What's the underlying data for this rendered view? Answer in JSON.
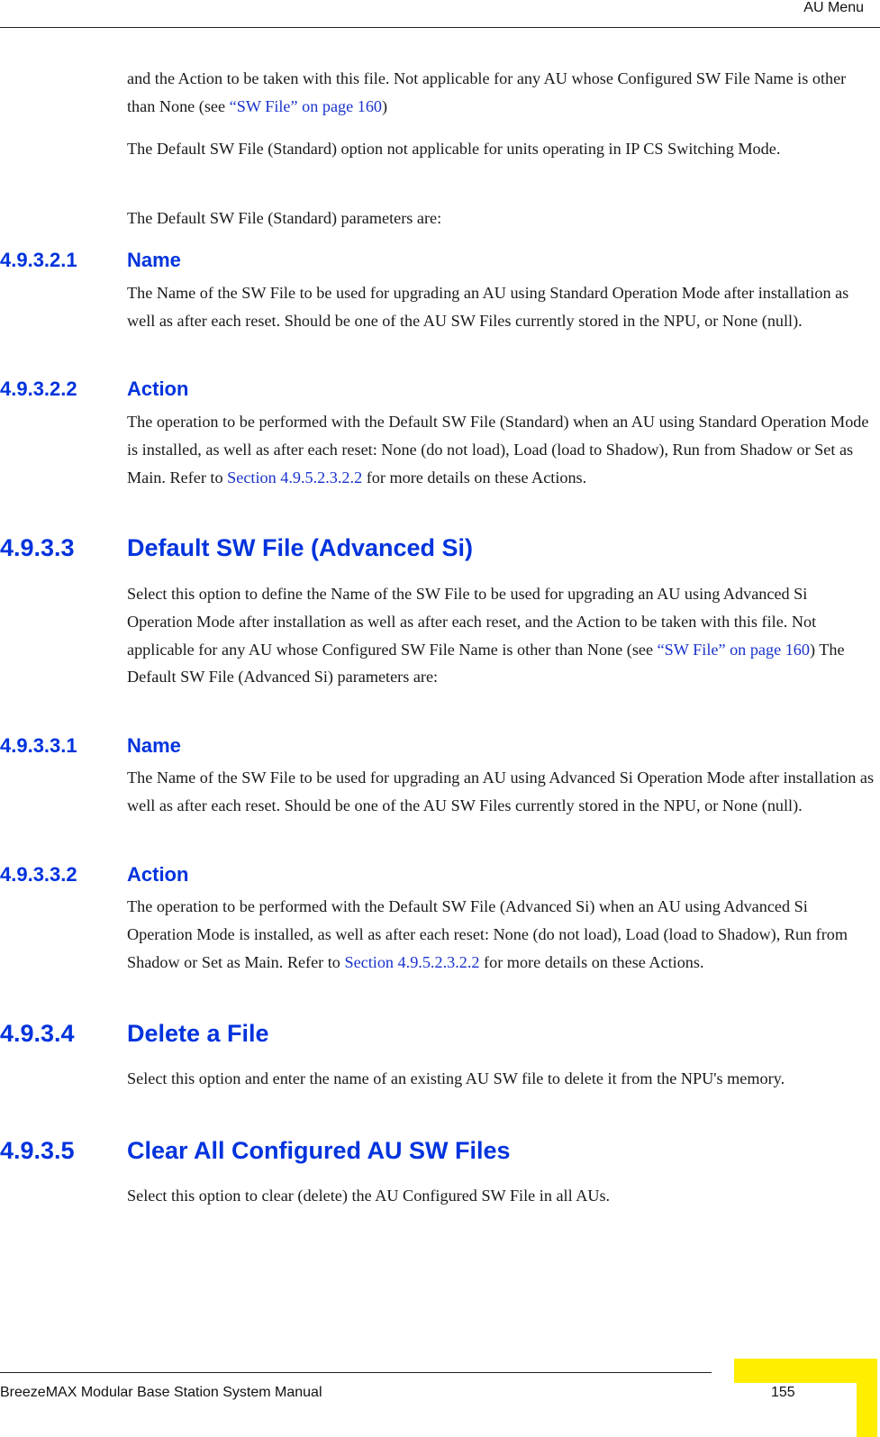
{
  "header": {
    "running_title": "AU Menu"
  },
  "content": {
    "intro": {
      "p1_text": "and the Action to be taken with this file. Not applicable for any AU whose Configured SW File Name is other than None (see ",
      "p1_link": "“SW File” on page 160",
      "p1_after": ")",
      "p2": "The Default SW File (Standard) option not applicable for units operating in IP CS Switching Mode.",
      "p3": "The Default SW File (Standard) parameters are:"
    },
    "s_4_9_3_2_1": {
      "number": "4.9.3.2.1",
      "title": "Name",
      "body": "The Name of the SW File to be used for upgrading an AU using Standard Operation Mode after installation as well as after each reset. Should be one of the AU SW Files currently stored in the NPU, or None (null)."
    },
    "s_4_9_3_2_2": {
      "number": "4.9.3.2.2",
      "title": "Action",
      "body": "The operation to be performed with the Default SW File (Standard) when an AU using Standard Operation Mode is installed, as well as after each reset: None (do not load), Load (load to Shadow), Run from Shadow or Set as Main. Refer to ",
      "link": "Section 4.9.5.2.3.2.2",
      "after": " for more details on these Actions."
    },
    "s_4_9_3_3": {
      "number": "4.9.3.3",
      "title": "Default SW File (Advanced Si)",
      "body": "Select this option to define the Name of the SW File to be used for upgrading an AU using Advanced Si Operation Mode after installation as well as after each reset, and the Action to be taken with this file. Not applicable for any AU whose Configured SW File Name is other than None (see ",
      "link": "“SW File” on page 160",
      "after": ") The Default SW File (Advanced Si) parameters are:"
    },
    "s_4_9_3_3_1": {
      "number": "4.9.3.3.1",
      "title": "Name",
      "body": "The Name of the SW File to be used for upgrading an AU using Advanced Si Operation Mode after installation as well as after each reset. Should be one of the AU SW Files currently stored in the NPU, or None (null)."
    },
    "s_4_9_3_3_2": {
      "number": "4.9.3.3.2",
      "title": "Action",
      "body": "The operation to be performed with the Default SW File (Advanced Si) when an AU using Advanced Si Operation Mode is installed, as well as after each reset: None (do not load), Load (load to Shadow), Run from Shadow or Set as Main. Refer to ",
      "link": "Section 4.9.5.2.3.2.2",
      "after": " for more details on these Actions."
    },
    "s_4_9_3_4": {
      "number": "4.9.3.4",
      "title": "Delete a File",
      "body": "Select this option and enter the name of an existing AU SW file to delete it from the NPU's memory."
    },
    "s_4_9_3_5": {
      "number": "4.9.3.5",
      "title": "Clear All Configured AU SW Files",
      "body": "Select this option to clear (delete) the AU Configured SW File in all AUs."
    }
  },
  "footer": {
    "manual_title": "BreezeMAX Modular Base Station System Manual",
    "page_number": "155"
  },
  "colors": {
    "heading": "#0033dd",
    "link": "#1a33cc",
    "tab": "#ffee00"
  }
}
